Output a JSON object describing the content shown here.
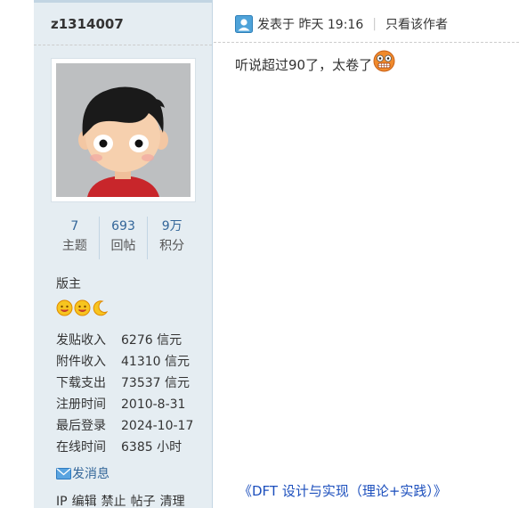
{
  "author": {
    "username": "z1314007",
    "stats": [
      {
        "value": "7",
        "label": "主题"
      },
      {
        "value": "693",
        "label": "回帖"
      },
      {
        "value": "9万",
        "label": "积分"
      }
    ],
    "group": "版主",
    "info": [
      {
        "key": "发贴收入",
        "value": "6276 信元"
      },
      {
        "key": "附件收入",
        "value": "41310 信元"
      },
      {
        "key": "下载支出",
        "value": "73537 信元"
      },
      {
        "key": "注册时间",
        "value": "2010-8-31"
      },
      {
        "key": "最后登录",
        "value": "2024-10-17"
      },
      {
        "key": "在线时间",
        "value": "6385 小时"
      }
    ],
    "pm_label": "发消息",
    "admin_actions": [
      "IP",
      "编辑",
      "禁止",
      "帖子",
      "清理"
    ]
  },
  "post": {
    "posted_label": "发表于 昨天 19:16",
    "only_author": "只看该作者",
    "message": "听说超过90了，太卷了",
    "book_link": "《DFT 设计与实现（理论+实践）》"
  },
  "colors": {
    "sidebar_bg": "#e5edf2",
    "link_blue": "#336699",
    "book_link": "#1c4fbd"
  }
}
